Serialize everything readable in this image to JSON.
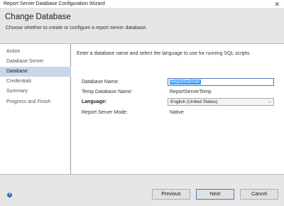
{
  "window": {
    "title": "Report Server Database Configuration Wizard",
    "close_glyph": "✕"
  },
  "header": {
    "title": "Change Database",
    "subtitle": "Choose whether to create or configure a report server database."
  },
  "sidebar": {
    "items": [
      {
        "label": "Action",
        "active": false
      },
      {
        "label": "Database Server",
        "active": false
      },
      {
        "label": "Database",
        "active": true
      },
      {
        "label": "Credentials",
        "active": false
      },
      {
        "label": "Summary",
        "active": false
      },
      {
        "label": "Progress and Finish",
        "active": false
      }
    ]
  },
  "main": {
    "intro": "Enter a database name and select the language to use for running SQL scripts.",
    "database_name": {
      "label": "Database Name:",
      "value": "ReportServer"
    },
    "temp_database_name": {
      "label": "Temp Database Name:",
      "value": "ReportServerTemp"
    },
    "language": {
      "label": "Language:",
      "value": "English (United States)"
    },
    "report_server_mode": {
      "label": "Report Server Mode:",
      "value": "Native"
    }
  },
  "footer": {
    "help_glyph": "?",
    "previous_label": "Previous",
    "next_label": "Next",
    "cancel_label": "Cancel"
  },
  "colors": {
    "accent": "#3399ff",
    "active_nav": "#c9d7ea",
    "panel": "#e6e6e6"
  }
}
